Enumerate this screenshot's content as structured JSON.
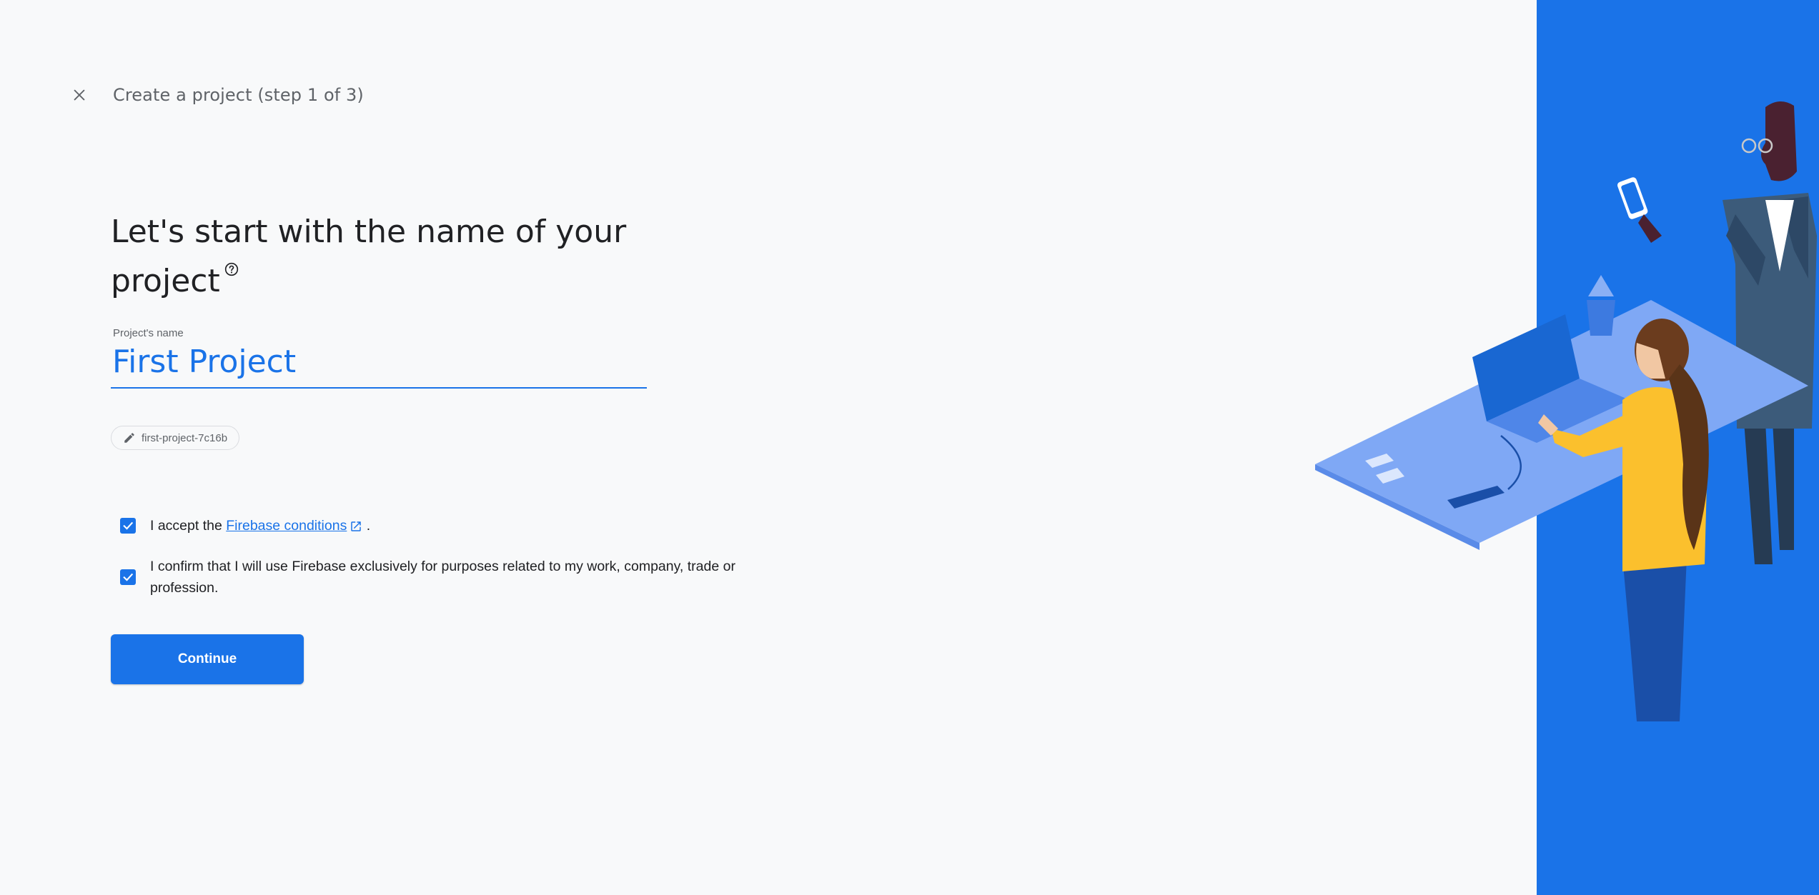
{
  "header": {
    "close_icon": "close-icon",
    "title": "Create a project (step 1 of 3)"
  },
  "heading": {
    "text": "Let's start with the name of your project",
    "help_icon": "help-circle-icon"
  },
  "project_name_field": {
    "label": "Project's name",
    "value": "First Project"
  },
  "project_id_chip": {
    "icon": "pencil-icon",
    "text": "first-project-7c16b"
  },
  "checkboxes": [
    {
      "checked": true,
      "prefix": "I accept the ",
      "link_text": "Firebase conditions",
      "link_icon": "external-link-icon",
      "suffix": " ."
    },
    {
      "checked": true,
      "text": "I confirm that I will use Firebase exclusively for purposes related to my work, company, trade or profession."
    }
  ],
  "continue_button": {
    "label": "Continue"
  },
  "colors": {
    "accent": "#1a73e8",
    "background": "#f8f9fa",
    "text": "#202124",
    "muted": "#5f6368"
  }
}
